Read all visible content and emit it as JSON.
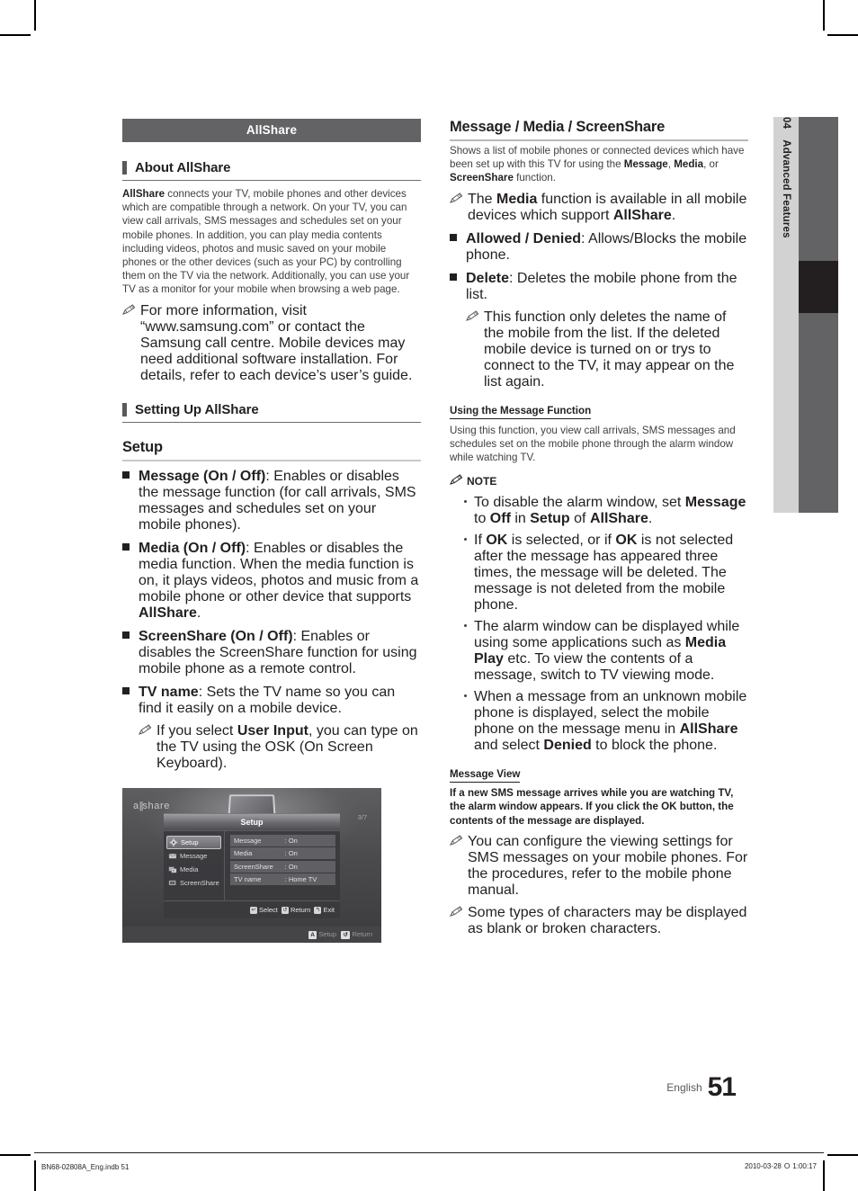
{
  "chapter_tab": {
    "number": "04",
    "name": "Advanced Features"
  },
  "left_column": {
    "banner": "AllShare",
    "about_heading": "About AllShare",
    "about_paragraph_lead": "AllShare",
    "about_paragraph_rest": " connects your TV, mobile phones and other devices which are compatible through a network. On your TV, you can view call arrivals, SMS messages and schedules set on your mobile phones. In addition, you can play media contents including videos, photos and music saved on your mobile phones or the other devices (such as your PC) by controlling them on the TV via the network. Additionally, you can use your TV as a monitor for your mobile when browsing a web page.",
    "about_note": "For more information, visit “www.samsung.com” or contact the Samsung call centre. Mobile devices may need additional software installation. For details, refer to each device’s user’s guide.",
    "setting_up_heading": "Setting Up AllShare",
    "setup_heading": "Setup",
    "setup_items": [
      {
        "term": "Message (On / Off)",
        "text": ": Enables or disables the message function (for call arrivals, SMS messages and schedules set on your mobile phones)."
      },
      {
        "term": "Media (On / Off)",
        "text": ": Enables or disables the media function. When the media function is on, it plays videos, photos and music from a mobile phone or other device that supports ",
        "tail_bold": "AllShare",
        "tail": "."
      },
      {
        "term": "ScreenShare (On / Off)",
        "text": ": Enables or disables the ScreenShare function for using mobile phone as a remote control."
      },
      {
        "term": "TV name",
        "text": ": Sets the TV name so you can find it easily on a mobile device."
      }
    ],
    "tv_name_note_pre": "If you select ",
    "tv_name_note_bold": "User Input",
    "tv_name_note_post": ", you can type on the TV using the OSK (On Screen Keyboard)."
  },
  "figure": {
    "logo": "allshare",
    "page_indicator": "3/7",
    "osd_title": "Setup",
    "menu_items": [
      {
        "label": "Setup",
        "icon": "gear-icon",
        "selected": true
      },
      {
        "label": "Message",
        "icon": "envelope-icon",
        "selected": false
      },
      {
        "label": "Media",
        "icon": "media-icon",
        "selected": false
      },
      {
        "label": "ScreenShare",
        "icon": "screen-icon",
        "selected": false
      }
    ],
    "settings_rows": [
      {
        "key": "Message",
        "value": ": On"
      },
      {
        "key": "Media",
        "value": ": On"
      },
      {
        "key": "ScreenShare",
        "value": ": On"
      },
      {
        "key": "TV name",
        "value": ": Home TV"
      }
    ],
    "footer_hints": [
      {
        "key": "↵",
        "label": "Select"
      },
      {
        "key": "↺",
        "label": "Return"
      },
      {
        "key": "↰",
        "label": "Exit"
      }
    ],
    "bottom_hints": [
      {
        "key": "A",
        "label": "Setup"
      },
      {
        "key": "↺",
        "label": "Return"
      }
    ]
  },
  "right_column": {
    "heading": "Message / Media / ScreenShare",
    "intro_1": "Shows a list of mobile phones or connected devices which have been set up with this TV for using the ",
    "intro_b1": "Message",
    "intro_2": ", ",
    "intro_b2": "Media",
    "intro_3": ", or ",
    "intro_b3": "ScreenShare",
    "intro_4": " function.",
    "media_note_1": "The ",
    "media_note_b1": "Media",
    "media_note_2": " function is available in all mobile devices which support ",
    "media_note_b2": "AllShare",
    "media_note_3": ".",
    "items": [
      {
        "term": "Allowed / Denied",
        "text": ": Allows/Blocks the mobile phone."
      },
      {
        "term": "Delete",
        "text": ": Deletes the mobile phone from the list."
      }
    ],
    "delete_note": "This function only deletes the name of the mobile from the list. If the deleted mobile device is turned on or trys to connect to the TV, it may appear on the list again.",
    "using_msg_heading": "Using the Message Function",
    "using_msg_paragraph": "Using this function, you view call arrivals, SMS messages and schedules set on the mobile phone through the alarm window while watching TV.",
    "note_label": "NOTE",
    "notes": [
      {
        "segments": [
          {
            "t": "To disable the alarm window, set ",
            "b": false
          },
          {
            "t": "Message",
            "b": true
          },
          {
            "t": " to ",
            "b": false
          },
          {
            "t": "Off",
            "b": true
          },
          {
            "t": " in ",
            "b": false
          },
          {
            "t": "Setup",
            "b": true
          },
          {
            "t": " of ",
            "b": false
          },
          {
            "t": "AllShare",
            "b": true
          },
          {
            "t": ".",
            "b": false
          }
        ]
      },
      {
        "segments": [
          {
            "t": "If ",
            "b": false
          },
          {
            "t": "OK",
            "b": true
          },
          {
            "t": " is selected, or if ",
            "b": false
          },
          {
            "t": "OK",
            "b": true
          },
          {
            "t": " is not selected after the message has appeared three times, the message will be deleted. The message is not deleted from the mobile phone.",
            "b": false
          }
        ]
      },
      {
        "segments": [
          {
            "t": "The alarm window can be displayed while using some applications such as ",
            "b": false
          },
          {
            "t": "Media Play",
            "b": true
          },
          {
            "t": " etc. To view the contents of a message, switch to TV viewing mode.",
            "b": false
          }
        ]
      },
      {
        "segments": [
          {
            "t": "When a message from an unknown mobile phone is displayed, select the mobile phone on the message menu in ",
            "b": false
          },
          {
            "t": "AllShare",
            "b": true
          },
          {
            "t": " and select ",
            "b": false
          },
          {
            "t": "Denied",
            "b": true
          },
          {
            "t": " to block the phone.",
            "b": false
          }
        ]
      }
    ],
    "message_view_heading": "Message View",
    "message_view_paragraph": "If a new SMS message arrives while you are watching TV, the alarm window appears. If you click the OK button, the contents of the message are displayed.",
    "message_view_note_1": "You can configure the viewing settings for SMS messages on your mobile phones. For the procedures, refer to the mobile phone manual.",
    "message_view_note_2": "Some types of characters may be displayed as blank or broken characters."
  },
  "footer": {
    "language": "English",
    "page_number": "51",
    "file_ref": "BN68-02808A_Eng.indb   51",
    "timestamp": "2010-03-28   Ｏ 1:00:17"
  }
}
